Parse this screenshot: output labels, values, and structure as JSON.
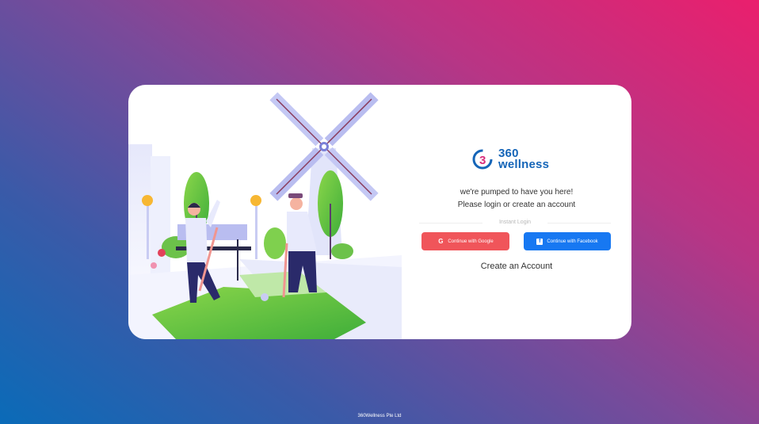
{
  "brand": {
    "line1": "360",
    "line2": "wellness"
  },
  "tagline": {
    "line1": "we're pumped to have you here!",
    "line2": "Please login or create an account"
  },
  "instant_login": "Instant Login",
  "buttons": {
    "google": "Continue with Google",
    "facebook": "Continue with Facebook"
  },
  "create_account": "Create an Account",
  "footer": "360Wellness Pte Ltd",
  "colors": {
    "brand_blue": "#1565b8",
    "google_button": "#f0555a",
    "facebook_button": "#1778f2",
    "bg_start": "#0a6bb8",
    "bg_end": "#ea1f6d"
  },
  "icons": {
    "logo": "logo-3-icon",
    "google": "google-icon",
    "facebook": "facebook-icon",
    "illustration": "golf-windmill-illustration"
  }
}
